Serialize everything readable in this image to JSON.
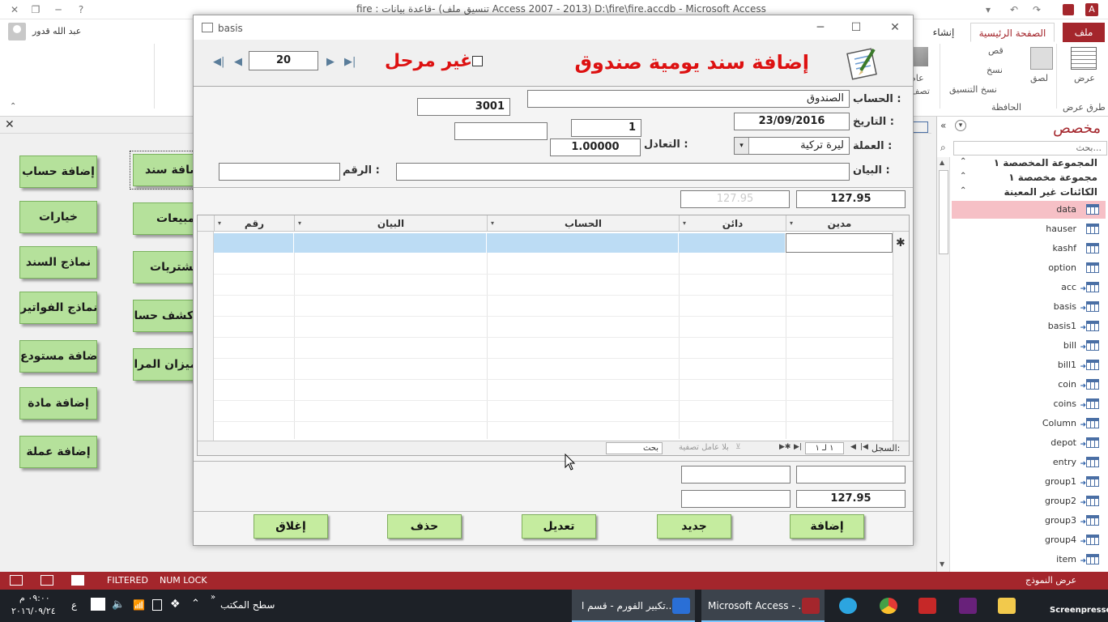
{
  "window": {
    "title": "fire : قاعدة بيانات- (تنسيق ملف Access 2007 - 2013) D:\\fire\\fire.accdb - Microsoft Access"
  },
  "ribbon": {
    "tabs": [
      "ملف",
      "الصفحة الرئيسية",
      "إنشاء"
    ],
    "user_name": "عبد الله قدور",
    "view_label": "عرض",
    "views_group": "طرق عرض",
    "paste_label": "لصق",
    "cut_label": "قص",
    "copy_label": "نسخ",
    "format_painter_label": "نسخ التنسيق",
    "clipboard_group": "الحافظة",
    "filter_label_a": "عام",
    "filter_label_b": "تصف"
  },
  "nav_pane": {
    "title": "مخصص",
    "search_placeholder": "بحث...",
    "groups": [
      "المجموعة المخصصة ١",
      "مجموعة مخصصة ١",
      "الكائنات غير المعينة"
    ],
    "items": [
      {
        "name": "data",
        "linked": false,
        "selected": true
      },
      {
        "name": "hauser",
        "linked": false
      },
      {
        "name": "kashf",
        "linked": false
      },
      {
        "name": "option",
        "linked": false
      },
      {
        "name": "acc",
        "linked": true
      },
      {
        "name": "basis",
        "linked": true
      },
      {
        "name": "basis1",
        "linked": true
      },
      {
        "name": "bill",
        "linked": true
      },
      {
        "name": "bill1",
        "linked": true
      },
      {
        "name": "coin",
        "linked": true
      },
      {
        "name": "coins",
        "linked": true
      },
      {
        "name": "Column",
        "linked": true
      },
      {
        "name": "depot",
        "linked": true
      },
      {
        "name": "entry",
        "linked": true
      },
      {
        "name": "group1",
        "linked": true
      },
      {
        "name": "group2",
        "linked": true
      },
      {
        "name": "group3",
        "linked": true
      },
      {
        "name": "group4",
        "linked": true
      },
      {
        "name": "item",
        "linked": true
      }
    ]
  },
  "switchboard": {
    "left_buttons": [
      "إضافة حساب",
      "خيارات",
      "نماذج السند",
      "نماذج الفواتير",
      "إضافة مستودع",
      "إضافة مادة",
      "إضافة عملة"
    ],
    "right_buttons": [
      "إضافة سند",
      "مبيعات",
      "مشتريات",
      "كشف حساب",
      "ميزان المراجعة"
    ]
  },
  "form": {
    "window_title": "basis",
    "heading": "إضافة سند يومية صندوق",
    "posted_label": "غير مرحل",
    "record_number": "20",
    "labels": {
      "account": "الحساب :",
      "date": "التاريخ :",
      "currency": "العملة :",
      "exchange": "التعادل :",
      "statement": "البيان :",
      "number": "الرقم :"
    },
    "values": {
      "account": "الصندوق",
      "account_code": "3001",
      "date": "23/09/2016",
      "currency": "ليرة تركية",
      "currency_id": "1",
      "exchange": "1.00000",
      "total_top": "127.95",
      "total_top_faded": "127.95",
      "total_bottom": "127.95"
    },
    "grid": {
      "columns": [
        "مدين",
        "دائن",
        "الحساب",
        "البيان",
        "رقم"
      ],
      "nav": {
        "label": "السجل:",
        "position": "١ لـ ١",
        "filter": "بلا عامل تصفية",
        "search": "بحث"
      }
    },
    "buttons": [
      "إضافة",
      "جديد",
      "تعديل",
      "حذف",
      "إغلاق"
    ]
  },
  "statusbar": {
    "left_text": "عرض النموذج",
    "filtered": "FILTERED",
    "numlock": "NUM LOCK"
  },
  "taskbar": {
    "clock_time": "٠٩:٠٠ م",
    "clock_date": "٢٠١٦/٠٩/٢٤",
    "desktop_label": "سطح المكتب",
    "apps": [
      "Microsoft Access - ...",
      "تكبير الفورم - قسم ا..."
    ],
    "screenpresso": "Screenpresso",
    "lang": "ع"
  }
}
